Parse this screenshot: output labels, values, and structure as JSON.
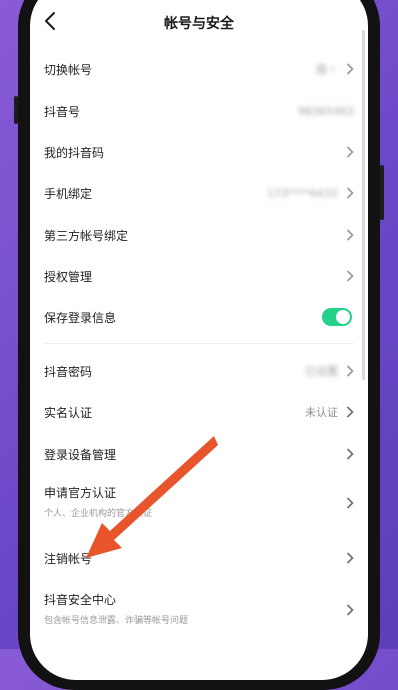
{
  "header": {
    "title": "帐号与安全"
  },
  "rows": [
    {
      "label": "切换帐号",
      "value": "我丶",
      "value_blurred": true
    },
    {
      "label": "抖音号",
      "value": "98365463",
      "value_blurred": true
    },
    {
      "label": "我的抖音码"
    },
    {
      "label": "手机绑定",
      "value": "173****6432",
      "value_blurred": true
    },
    {
      "label": "第三方帐号绑定"
    },
    {
      "label": "授权管理"
    },
    {
      "label": "保存登录信息",
      "toggle_on": true
    },
    {
      "label": "抖音密码",
      "value": "已设置",
      "value_blurred": true
    },
    {
      "label": "实名认证",
      "value": "未认证"
    },
    {
      "label": "登录设备管理"
    },
    {
      "label": "申请官方认证",
      "sub": "个人、企业机构的官方认证"
    },
    {
      "label": "注销帐号"
    },
    {
      "label": "抖音安全中心",
      "sub": "包含帐号信息泄露、诈骗等帐号问题"
    }
  ],
  "colors": {
    "toggle_on": "#24d08a",
    "annotation_arrow": "#e8542c"
  }
}
